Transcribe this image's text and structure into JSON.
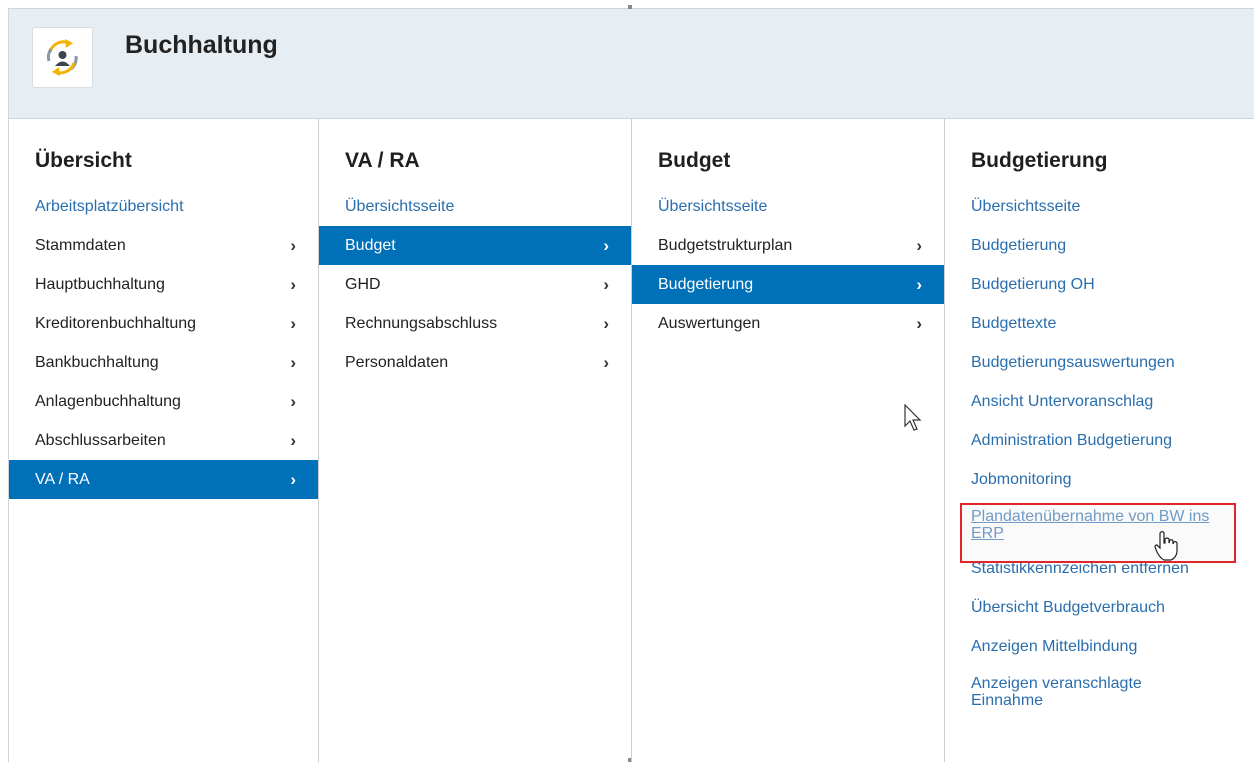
{
  "header": {
    "title": "Buchhaltung",
    "app_icon": "person-refresh-icon"
  },
  "columns": [
    {
      "title": "Übersicht",
      "items": [
        {
          "label": "Arbeitsplatzübersicht",
          "link": true,
          "arrow": false,
          "active": false
        },
        {
          "label": "Stammdaten",
          "link": false,
          "arrow": true,
          "active": false
        },
        {
          "label": "Hauptbuchhaltung",
          "link": false,
          "arrow": true,
          "active": false
        },
        {
          "label": "Kreditorenbuchhaltung",
          "link": false,
          "arrow": true,
          "active": false
        },
        {
          "label": "Bankbuchhaltung",
          "link": false,
          "arrow": true,
          "active": false
        },
        {
          "label": "Anlagenbuchhaltung",
          "link": false,
          "arrow": true,
          "active": false
        },
        {
          "label": "Abschlussarbeiten",
          "link": false,
          "arrow": true,
          "active": false
        },
        {
          "label": "VA / RA",
          "link": false,
          "arrow": true,
          "active": true
        }
      ]
    },
    {
      "title": "VA / RA",
      "items": [
        {
          "label": "Übersichtsseite",
          "link": true,
          "arrow": false,
          "active": false
        },
        {
          "label": "Budget",
          "link": false,
          "arrow": true,
          "active": true
        },
        {
          "label": "GHD",
          "link": false,
          "arrow": true,
          "active": false
        },
        {
          "label": "Rechnungsabschluss",
          "link": false,
          "arrow": true,
          "active": false
        },
        {
          "label": "Personaldaten",
          "link": false,
          "arrow": true,
          "active": false
        }
      ]
    },
    {
      "title": "Budget",
      "items": [
        {
          "label": "Übersichtsseite",
          "link": true,
          "arrow": false,
          "active": false
        },
        {
          "label": "Budgetstrukturplan",
          "link": false,
          "arrow": true,
          "active": false
        },
        {
          "label": "Budgetierung",
          "link": false,
          "arrow": true,
          "active": true
        },
        {
          "label": "Auswertungen",
          "link": false,
          "arrow": true,
          "active": false
        }
      ]
    },
    {
      "title": "Budgetierung",
      "items": [
        {
          "label": "Übersichtsseite",
          "link": true
        },
        {
          "label": "Budgetierung",
          "link": true
        },
        {
          "label": "Budgetierung OH",
          "link": true
        },
        {
          "label": "Budgettexte",
          "link": true
        },
        {
          "label": "Budgetierungsauswertungen",
          "link": true
        },
        {
          "label": "Ansicht Untervoranschlag",
          "link": true
        },
        {
          "label": "Administration Budgetierung",
          "link": true
        },
        {
          "label": "Jobmonitoring",
          "link": true
        },
        {
          "label": "Plandatenübernahme von BW ins ERP",
          "link": true,
          "highlighted": true
        },
        {
          "label": "Statistikkennzeichen entfernen",
          "link": true
        },
        {
          "label": "Übersicht Budgetverbrauch",
          "link": true
        },
        {
          "label": "Anzeigen Mittelbindung",
          "link": true
        },
        {
          "label": "Anzeigen veranschlagte Einnahme",
          "link": true
        }
      ]
    }
  ],
  "chevron_glyph": "›",
  "colors": {
    "active_bg": "#0070b8",
    "link": "#2a6eae",
    "highlight_border": "#e0262b",
    "header_bg": "#e6edf3"
  }
}
